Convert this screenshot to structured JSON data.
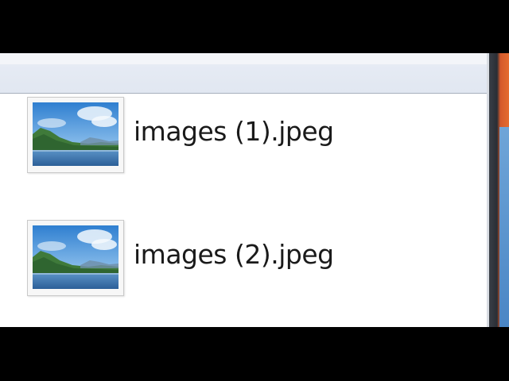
{
  "file_list": {
    "items": [
      {
        "name": "images (1).jpeg",
        "icon": "jpeg-landscape-thumbnail-icon"
      },
      {
        "name": "images (2).jpeg",
        "icon": "jpeg-landscape-thumbnail-icon"
      }
    ]
  },
  "colors": {
    "background": "#000000",
    "window": "#ffffff",
    "header": "#e3e9f2",
    "text": "#1a1a1a"
  }
}
